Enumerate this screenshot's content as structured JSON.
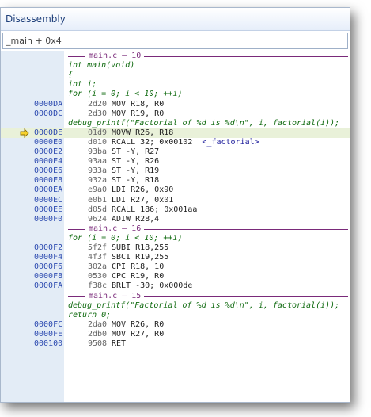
{
  "window": {
    "title": "Disassembly"
  },
  "address_bar": {
    "value": "_main + 0x4"
  },
  "lines": [
    {
      "kind": "separator",
      "text": "main.c — 10"
    },
    {
      "kind": "source",
      "text": "int main(void)"
    },
    {
      "kind": "source",
      "text": "{"
    },
    {
      "kind": "source",
      "text": "int i;"
    },
    {
      "kind": "source",
      "text": "for (i = 0; i < 10; ++i)"
    },
    {
      "kind": "asm",
      "addr": "0000DA",
      "opcode": "2d20",
      "instr": "MOV R18, R0"
    },
    {
      "kind": "asm",
      "addr": "0000DC",
      "opcode": "2d30",
      "instr": "MOV R19, R0"
    },
    {
      "kind": "source",
      "text": "debug_printf(\"Factorial of %d is %d\\n\", i, factorial(i));"
    },
    {
      "kind": "asm",
      "addr": "0000DE",
      "opcode": "01d9",
      "instr": "MOVW R26, R18",
      "current": true
    },
    {
      "kind": "asm",
      "addr": "0000E0",
      "opcode": "d010",
      "instr": "RCALL 32; 0x00102",
      "symbol": "<_factorial>"
    },
    {
      "kind": "asm",
      "addr": "0000E2",
      "opcode": "93ba",
      "instr": "ST -Y, R27"
    },
    {
      "kind": "asm",
      "addr": "0000E4",
      "opcode": "93aa",
      "instr": "ST -Y, R26"
    },
    {
      "kind": "asm",
      "addr": "0000E6",
      "opcode": "933a",
      "instr": "ST -Y, R19"
    },
    {
      "kind": "asm",
      "addr": "0000E8",
      "opcode": "932a",
      "instr": "ST -Y, R18"
    },
    {
      "kind": "asm",
      "addr": "0000EA",
      "opcode": "e9a0",
      "instr": "LDI R26, 0x90"
    },
    {
      "kind": "asm",
      "addr": "0000EC",
      "opcode": "e0b1",
      "instr": "LDI R27, 0x01"
    },
    {
      "kind": "asm",
      "addr": "0000EE",
      "opcode": "d05d",
      "instr": "RCALL 186; 0x001aa"
    },
    {
      "kind": "asm",
      "addr": "0000F0",
      "opcode": "9624",
      "instr": "ADIW R28,4"
    },
    {
      "kind": "separator",
      "text": "main.c — 16"
    },
    {
      "kind": "source",
      "text": "for (i = 0; i < 10; ++i)"
    },
    {
      "kind": "asm",
      "addr": "0000F2",
      "opcode": "5f2f",
      "instr": "SUBI R18,255"
    },
    {
      "kind": "asm",
      "addr": "0000F4",
      "opcode": "4f3f",
      "instr": "SBCI R19,255"
    },
    {
      "kind": "asm",
      "addr": "0000F6",
      "opcode": "302a",
      "instr": "CPI R18, 10"
    },
    {
      "kind": "asm",
      "addr": "0000F8",
      "opcode": "0530",
      "instr": "CPC R19, R0"
    },
    {
      "kind": "asm",
      "addr": "0000FA",
      "opcode": "f38c",
      "instr": "BRLT -30; 0x000de"
    },
    {
      "kind": "separator",
      "text": "main.c — 15"
    },
    {
      "kind": "source",
      "text": "debug_printf(\"Factorial of %d is %d\\n\", i, factorial(i));"
    },
    {
      "kind": "source",
      "text": "return 0;"
    },
    {
      "kind": "asm",
      "addr": "0000FC",
      "opcode": "2da0",
      "instr": "MOV R26, R0"
    },
    {
      "kind": "asm",
      "addr": "0000FE",
      "opcode": "2db0",
      "instr": "MOV R27, R0"
    },
    {
      "kind": "asm",
      "addr": "000100",
      "opcode": "9508",
      "instr": "RET"
    }
  ],
  "colors": {
    "title_text": "#1e3f7a",
    "address": "#2c4ab0",
    "source": "#116b11",
    "separator": "#7a2a7a",
    "current_line": "#e9f1d9",
    "gutter": "#e3ecf6"
  },
  "icons": {
    "current_instruction": "yellow-arrow-icon"
  }
}
